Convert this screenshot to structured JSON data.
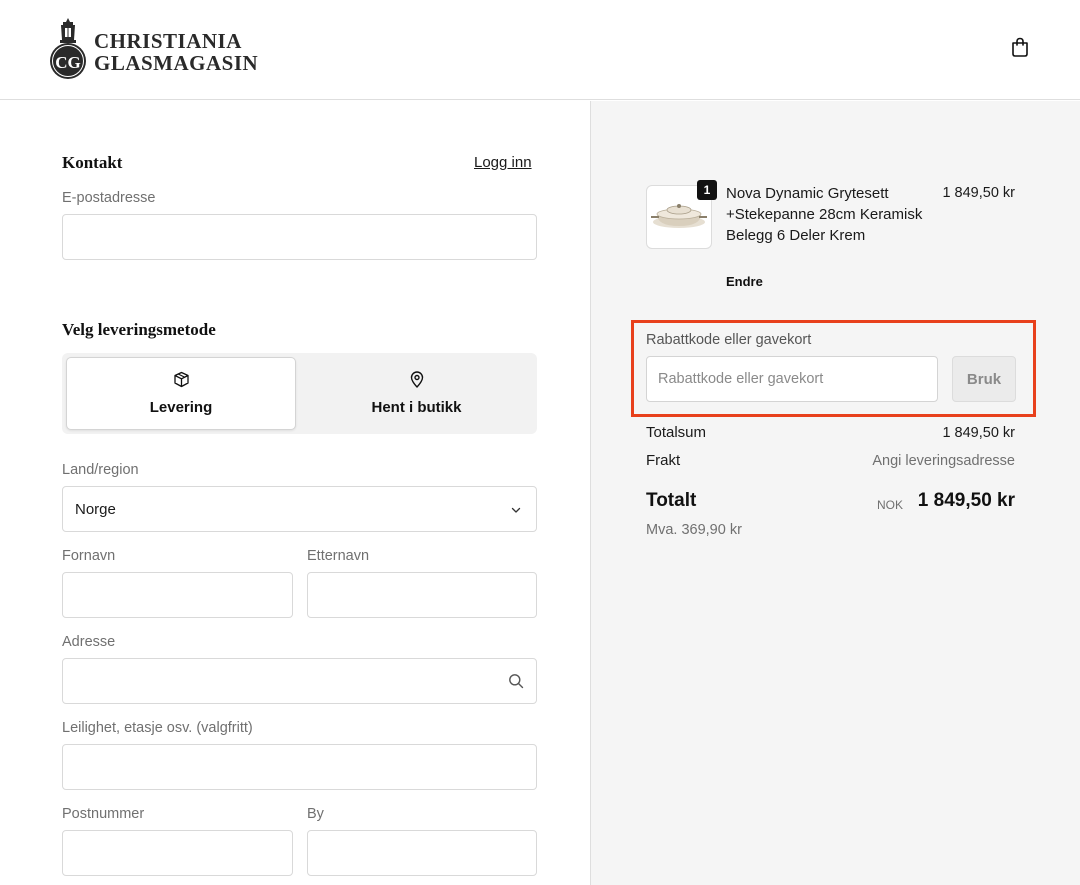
{
  "header": {
    "logo_line1": "CHRISTIANIA",
    "logo_line2": "GLASMAGASIN",
    "logo_mark": "CG",
    "cart_icon": "shopping-bag-icon"
  },
  "contact": {
    "title": "Kontakt",
    "login_label": "Logg inn",
    "email_label": "E-postadresse",
    "email_value": ""
  },
  "delivery": {
    "title": "Velg leveringsmetode",
    "options": [
      {
        "label": "Levering",
        "icon": "box-icon",
        "selected": true
      },
      {
        "label": "Hent i butikk",
        "icon": "location-pin-icon",
        "selected": false
      }
    ]
  },
  "address": {
    "country_label": "Land/region",
    "country_value": "Norge",
    "first_name_label": "Fornavn",
    "last_name_label": "Etternavn",
    "address_label": "Adresse",
    "apartment_label": "Leilighet, etasje osv. (valgfritt)",
    "postal_label": "Postnummer",
    "city_label": "By"
  },
  "summary": {
    "item": {
      "quantity": "1",
      "name": "Nova Dynamic Grytesett +Stekepanne 28cm Keramisk Belegg 6 Deler Krem",
      "price": "1 849,50 kr",
      "edit_label": "Endre"
    },
    "discount": {
      "label": "Rabattkode eller gavekort",
      "placeholder": "Rabattkode eller gavekort",
      "apply_label": "Bruk",
      "highlight_color": "#e8401c"
    },
    "subtotal_label": "Totalsum",
    "subtotal_value": "1 849,50 kr",
    "shipping_label": "Frakt",
    "shipping_value": "Angi leveringsadresse",
    "total_label": "Totalt",
    "total_currency": "NOK",
    "total_value": "1 849,50 kr",
    "vat_label": "Mva. 369,90 kr"
  }
}
